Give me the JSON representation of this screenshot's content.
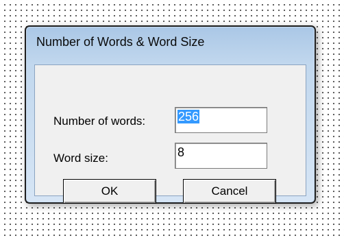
{
  "dialog": {
    "title": "Number of Words & Word Size"
  },
  "form": {
    "num_words_label": "Number of words:",
    "num_words_value": "256",
    "word_size_label": "Word size:",
    "word_size_value": "8"
  },
  "buttons": {
    "ok": "OK",
    "cancel": "Cancel"
  }
}
